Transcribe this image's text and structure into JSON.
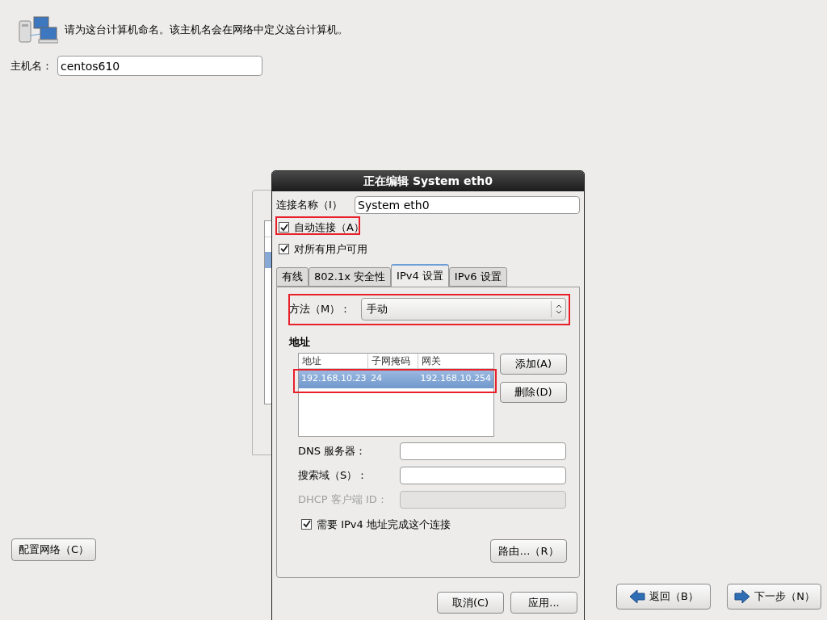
{
  "header": {
    "text": "请为这台计算机命名。该主机名会在网络中定义这台计算机。"
  },
  "hostname": {
    "label": "主机名：",
    "value": "centos610"
  },
  "configure_network_button": "配置网络（C）",
  "nav_buttons": [
    {
      "label": "返回（B）",
      "kind": "back"
    },
    {
      "label": "下一步（N）",
      "kind": "next"
    }
  ],
  "dialog": {
    "title": "正在编辑 System eth0",
    "connection_name": {
      "label": "连接名称（I）",
      "value": "System eth0"
    },
    "checkboxes": [
      {
        "label": "自动连接（A）",
        "checked": true,
        "highlighted": true
      },
      {
        "label": "对所有用户可用",
        "checked": true,
        "highlighted": false
      }
    ],
    "tabs": [
      {
        "label": "有线",
        "selected": false
      },
      {
        "label": "802.1x 安全性",
        "selected": false
      },
      {
        "label": "IPv4 设置",
        "selected": true
      },
      {
        "label": "IPv6 设置",
        "selected": false
      }
    ],
    "method": {
      "label": "方法（M）：",
      "value": "手动",
      "highlighted": true
    },
    "addresses": {
      "title": "地址",
      "columns": [
        "地址",
        "子网掩码",
        "网关"
      ],
      "rows": [
        {
          "cells": [
            "192.168.10.23",
            "24",
            "192.168.10.254"
          ],
          "selected": true,
          "highlighted": true
        }
      ],
      "buttons": [
        "添加(A)",
        "删除(D)"
      ]
    },
    "fields": [
      {
        "label": "DNS 服务器：",
        "disabled": false
      },
      {
        "label": "搜索域（S）：",
        "disabled": false
      },
      {
        "label": "DHCP 客户端 ID：",
        "disabled": true
      }
    ],
    "require_ipv4": {
      "label": "需要 IPv4 地址完成这个连接",
      "checked": true
    },
    "routes_button": "路由…（R）",
    "buttons": [
      "取消(C)",
      "应用..."
    ]
  }
}
